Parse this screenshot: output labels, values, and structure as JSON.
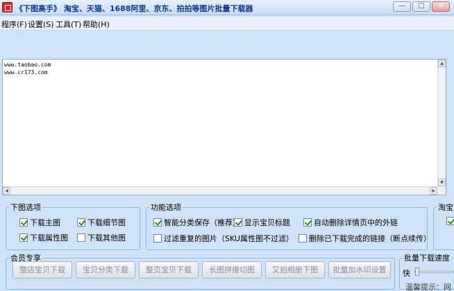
{
  "window": {
    "title": "《下图高手》 淘宝、天猫、1688阿里、京东、拍拍等图片批量下载器",
    "minimize": "—",
    "maximize": "□",
    "close": "✕"
  },
  "menu": [
    "程序(F)",
    "设置(S)",
    "工具(T)",
    "帮助(H)"
  ],
  "url_box": {
    "text": "www.taobao.com\nwww.cr173.com"
  },
  "download_options": {
    "legend": "下图选项",
    "items": [
      {
        "label": "下载主图",
        "checked": true
      },
      {
        "label": "下载细节图",
        "checked": true
      },
      {
        "label": "下载属性图",
        "checked": true
      },
      {
        "label": "下载其他图",
        "checked": false
      }
    ]
  },
  "function_options": {
    "legend": "功能选项",
    "items": [
      {
        "label": "智能分类保存（推荐）",
        "checked": true
      },
      {
        "label": "显示宝贝标题",
        "checked": true
      },
      {
        "label": "自动删除详情页中的外链",
        "checked": true
      },
      {
        "label": "过滤重复的图片（SKU属性图不过滤）",
        "checked": false
      },
      {
        "label": "删除已下载完成的链接（断点续传）",
        "checked": false
      }
    ]
  },
  "taobao_group": {
    "legend": "淘宝",
    "checked": true
  },
  "member": {
    "legend": "会员专享",
    "buttons": [
      "整店宝贝下载",
      "宝贝分类下载",
      "整页宝贝下载",
      "长图拼接切图",
      "又拍相册下图",
      "批量加水印设置"
    ]
  },
  "speed": {
    "legend": "批量下载速度",
    "label": "快",
    "value": 0.05
  },
  "tip": "温馨提示：网"
}
